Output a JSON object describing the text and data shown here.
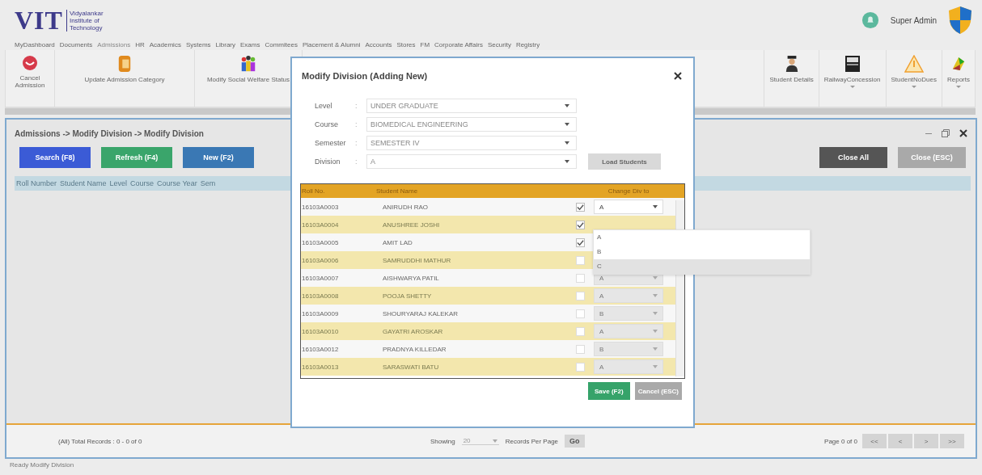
{
  "header": {
    "logo": "VIT",
    "institute": [
      "Vidyalankar",
      "Institute of",
      "Technology"
    ],
    "user": "Super Admin"
  },
  "menu": [
    {
      "label": "MyDashboard",
      "selected": false
    },
    {
      "label": "Documents",
      "selected": false
    },
    {
      "label": "Admissions",
      "selected": true
    },
    {
      "label": "HR",
      "selected": false
    },
    {
      "label": "Academics",
      "selected": false
    },
    {
      "label": "Systems",
      "selected": false
    },
    {
      "label": "Library",
      "selected": false
    },
    {
      "label": "Exams",
      "selected": false
    },
    {
      "label": "Commitees",
      "selected": false
    },
    {
      "label": "Placement & Alumni",
      "selected": false
    },
    {
      "label": "Accounts",
      "selected": false
    },
    {
      "label": "Stores",
      "selected": false
    },
    {
      "label": "FM",
      "selected": false
    },
    {
      "label": "Corporate Affairs",
      "selected": false
    },
    {
      "label": "Security",
      "selected": false
    },
    {
      "label": "Registry",
      "selected": false
    }
  ],
  "toolbar_left": [
    {
      "kind": "cancel",
      "label": "Cancel Admission",
      "dropdown": false
    },
    {
      "kind": "category",
      "label": "Update Admission Category",
      "dropdown": false
    },
    {
      "kind": "people",
      "label": "Modify Social Welfare Status",
      "dropdown": false
    }
  ],
  "toolbar_right": [
    {
      "kind": "student",
      "label": "Student Details",
      "dropdown": false
    },
    {
      "kind": "document",
      "label": "RailwayConcession",
      "dropdown": true
    },
    {
      "kind": "warning",
      "label": "StudentNoDues",
      "dropdown": true
    },
    {
      "kind": "chart",
      "label": "Reports",
      "dropdown": true
    }
  ],
  "panel": {
    "breadcrumb": "Admissions -> Modify Division -> Modify Division",
    "buttons": [
      {
        "kind": "search",
        "label": "Search (F8)"
      },
      {
        "kind": "refresh",
        "label": "Refresh (F4)"
      },
      {
        "kind": "new",
        "label": "New (F2)"
      }
    ],
    "right_buttons": [
      {
        "label": "Close All",
        "disabled": false
      },
      {
        "label": "Close (ESC)",
        "disabled": true
      }
    ],
    "columns": [
      "Roll Number",
      "Student Name",
      "Level",
      "Course",
      "Course Year",
      "Sem"
    ],
    "footer": {
      "total": "(All) Total Records : 0 - 0 of 0",
      "showing": "Showing",
      "per_page": "20",
      "records_per_page": "Records Per Page",
      "go": "Go",
      "page": "Page 0 of 0",
      "nav": [
        "<<",
        "<",
        ">",
        ">>"
      ]
    }
  },
  "dialog": {
    "title": "Modify Division (Adding New)",
    "fields": [
      {
        "label": "Level",
        "separator": ":",
        "value": "UNDER GRADUATE"
      },
      {
        "label": "Course",
        "separator": ":",
        "value": "BIOMEDICAL ENGINEERING"
      },
      {
        "label": "Semester",
        "separator": ":",
        "value": "SEMESTER IV"
      },
      {
        "label": "Division",
        "separator": ":",
        "value": "A"
      }
    ],
    "load_button": "Load Students",
    "columns": [
      "Roll No.",
      "Student Name",
      "Change Div to"
    ],
    "rows": [
      {
        "roll": "16103A0003",
        "name": "ANIRUDH RAO",
        "checked": true,
        "division": "A"
      },
      {
        "roll": "16103A0004",
        "name": "ANUSHREE JOSHI",
        "checked": true
      },
      {
        "roll": "16103A0005",
        "name": "AMIT LAD",
        "checked": true
      },
      {
        "roll": "16103A0006",
        "name": "SAMRUDDHI MATHUR",
        "checked": false
      },
      {
        "roll": "16103A0007",
        "name": "AISHWARYA PATIL",
        "checked": false,
        "division": "A"
      },
      {
        "roll": "16103A0008",
        "name": "POOJA SHETTY",
        "checked": false,
        "division": "A"
      },
      {
        "roll": "16103A0009",
        "name": "SHOURYARAJ KALEKAR",
        "checked": false,
        "division": "B"
      },
      {
        "roll": "16103A0010",
        "name": "GAYATRI AROSKAR",
        "checked": false,
        "division": "A"
      },
      {
        "roll": "16103A0012",
        "name": "PRADNYA KILLEDAR",
        "checked": false,
        "division": "B"
      },
      {
        "roll": "16103A0013",
        "name": "SARASWATI BATU",
        "checked": false,
        "division": "A"
      }
    ],
    "dropdown": [
      {
        "label": "A",
        "selected": false
      },
      {
        "label": "B",
        "selected": false
      },
      {
        "label": "C",
        "selected": true
      }
    ],
    "save": "Save (F2)",
    "cancel": "Cancel (ESC)"
  },
  "status_bar": "Ready  Modify Division"
}
